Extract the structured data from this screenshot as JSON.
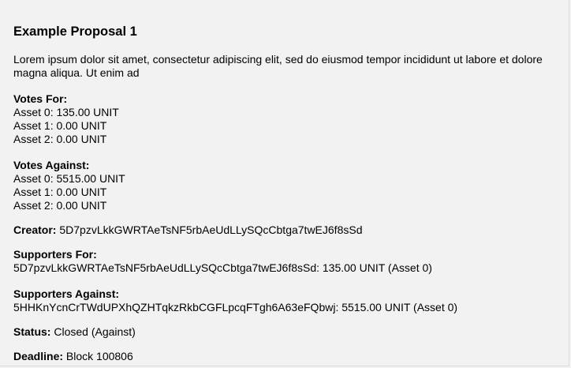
{
  "proposal": {
    "title": "Example Proposal 1",
    "description": "Lorem ipsum dolor sit amet, consectetur adipiscing elit, sed do eiusmod tempor incididunt ut labore et dolore magna aliqua. Ut enim ad",
    "votes_for": {
      "label": "Votes For:",
      "assets": [
        "Asset 0: 135.00 UNIT",
        "Asset 1: 0.00 UNIT",
        "Asset 2: 0.00 UNIT"
      ]
    },
    "votes_against": {
      "label": "Votes Against:",
      "assets": [
        "Asset 0: 5515.00 UNIT",
        "Asset 1: 0.00 UNIT",
        "Asset 2: 0.00 UNIT"
      ]
    },
    "creator": {
      "label": "Creator:",
      "value": "5D7pzvLkkGWRTAeTsNF5rbAeUdLLySQcCbtga7twEJ6f8sSd"
    },
    "supporters_for": {
      "label": "Supporters For:",
      "entries": [
        "5D7pzvLkkGWRTAeTsNF5rbAeUdLLySQcCbtga7twEJ6f8sSd: 135.00 UNIT (Asset 0)"
      ]
    },
    "supporters_against": {
      "label": "Supporters Against:",
      "entries": [
        "5HHKnYcnCrTWdUPXhQZHTqkzRkbCGFLpcqFTgh6A63eFQbwj: 5515.00 UNIT (Asset 0)"
      ]
    },
    "status": {
      "label": "Status:",
      "value": "Closed (Against)"
    },
    "deadline": {
      "label": "Deadline:",
      "value": "Block 100806"
    }
  }
}
